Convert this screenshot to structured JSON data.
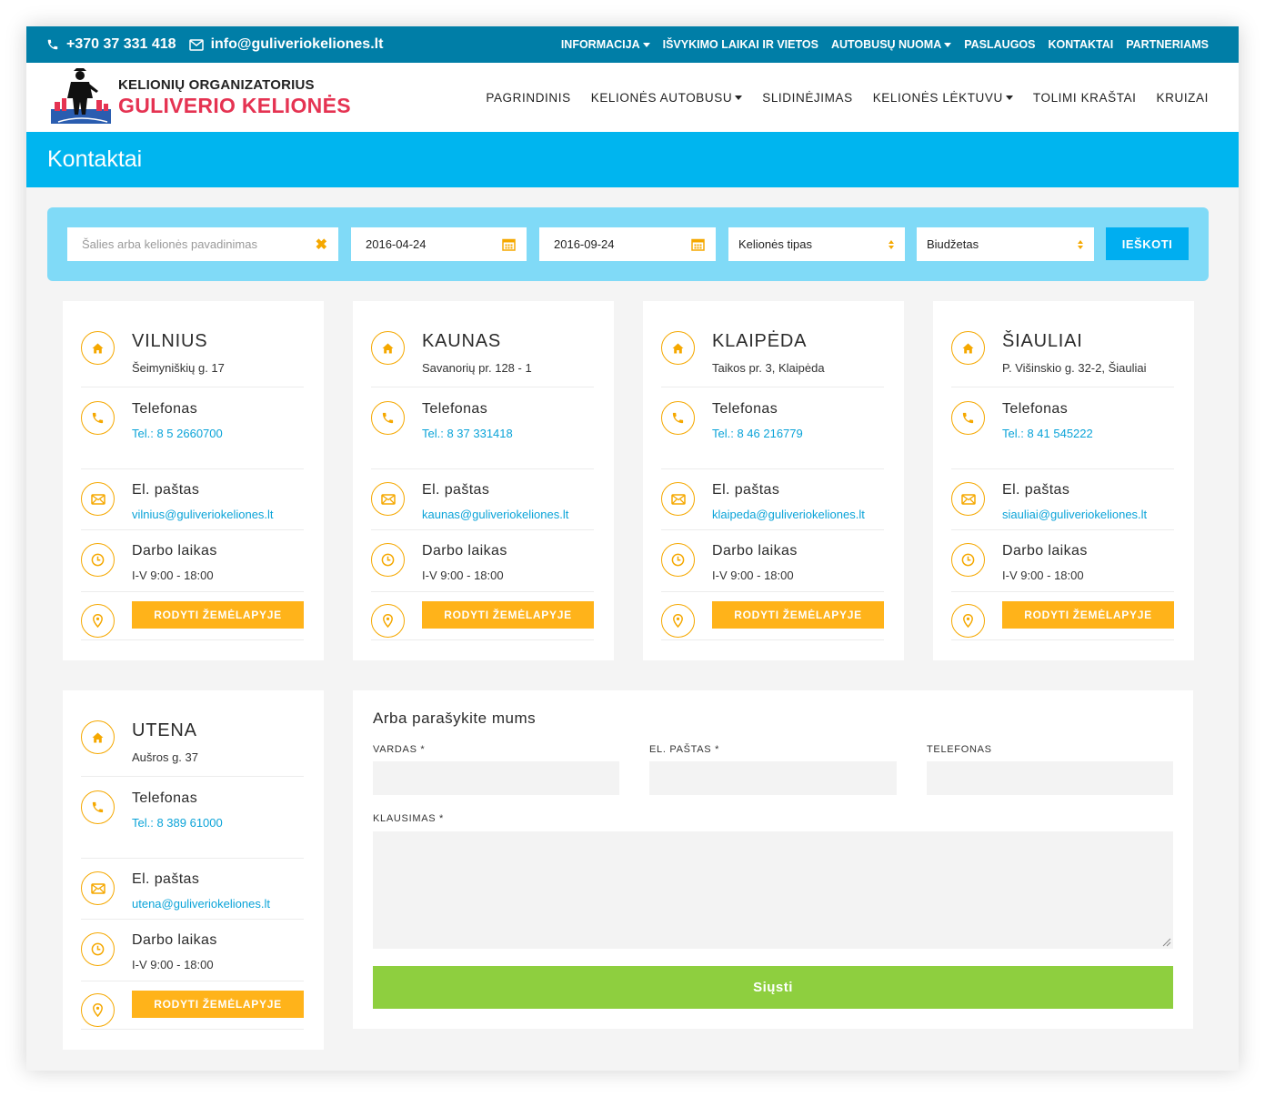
{
  "topbar": {
    "phone": "+370 37 331 418",
    "email": "info@guliveriokeliones.lt",
    "nav": [
      {
        "label": "INFORMACIJA",
        "dropdown": true
      },
      {
        "label": "IŠVYKIMO LAIKAI IR VIETOS",
        "dropdown": false
      },
      {
        "label": "AUTOBUSŲ NUOMA",
        "dropdown": true
      },
      {
        "label": "PASLAUGOS",
        "dropdown": false
      },
      {
        "label": "KONTAKTAI",
        "dropdown": false
      },
      {
        "label": "PARTNERIAMS",
        "dropdown": false
      }
    ]
  },
  "logo": {
    "line1": "KELIONIŲ ORGANIZATORIUS",
    "line2": "GULIVERIO KELIONĖS"
  },
  "mainnav": [
    {
      "label": "PAGRINDINIS",
      "dropdown": false
    },
    {
      "label": "KELIONĖS AUTOBUSU",
      "dropdown": true
    },
    {
      "label": "SLIDINĖJIMAS",
      "dropdown": false
    },
    {
      "label": "KELIONĖS LĖKTUVU",
      "dropdown": true
    },
    {
      "label": "TOLIMI KRAŠTAI",
      "dropdown": false
    },
    {
      "label": "KRUIZAI",
      "dropdown": false
    }
  ],
  "page_title": "Kontaktai",
  "search": {
    "name_placeholder": "Šalies arba kelionės pavadinimas",
    "date_from": "2016-04-24",
    "date_to": "2016-09-24",
    "type_selected": "Kelionės tipas",
    "budget_selected": "Biudžetas",
    "button": "IEŠKOTI"
  },
  "labels": {
    "phone": "Telefonas",
    "email": "El. paštas",
    "hours": "Darbo laikas",
    "map_button": "RODYTI ŽEMĖLAPYJE"
  },
  "offices": [
    {
      "city": "VILNIUS",
      "address": "Šeimyniškių g. 17",
      "phone": "Tel.: 8 5 2660700",
      "email": "vilnius@guliveriokeliones.lt",
      "hours": "I-V 9:00 - 18:00"
    },
    {
      "city": "KAUNAS",
      "address": "Savanorių pr. 128 - 1",
      "phone": "Tel.: 8 37 331418",
      "email": "kaunas@guliveriokeliones.lt",
      "hours": "I-V 9:00 - 18:00"
    },
    {
      "city": "KLAIPĖDA",
      "address": "Taikos pr. 3, Klaipėda",
      "phone": "Tel.: 8 46 216779",
      "email": "klaipeda@guliveriokeliones.lt",
      "hours": "I-V 9:00 - 18:00"
    },
    {
      "city": "ŠIAULIAI",
      "address": "P. Višinskio g. 32-2, Šiauliai",
      "phone": "Tel.: 8 41 545222",
      "email": "siauliai@guliveriokeliones.lt",
      "hours": "I-V 9:00 - 18:00"
    },
    {
      "city": "UTENA",
      "address": "Aušros g. 37",
      "phone": "Tel.: 8 389 61000",
      "email": "utena@guliveriokeliones.lt",
      "hours": "I-V 9:00 - 18:00"
    }
  ],
  "form": {
    "title": "Arba parašykite mums",
    "name_label": "VARDAS *",
    "email_label": "EL. PAŠTAS *",
    "phone_label": "TELEFONAS",
    "question_label": "KLAUSIMAS *",
    "submit": "Siųsti"
  },
  "colors": {
    "topbar": "#007ea7",
    "title_band": "#00b5ef",
    "search_panel": "#80daf7",
    "accent_orange": "#ffb31a",
    "link_blue": "#0aa3d8",
    "logo_red": "#e53352",
    "submit_green": "#8ecf3f"
  }
}
